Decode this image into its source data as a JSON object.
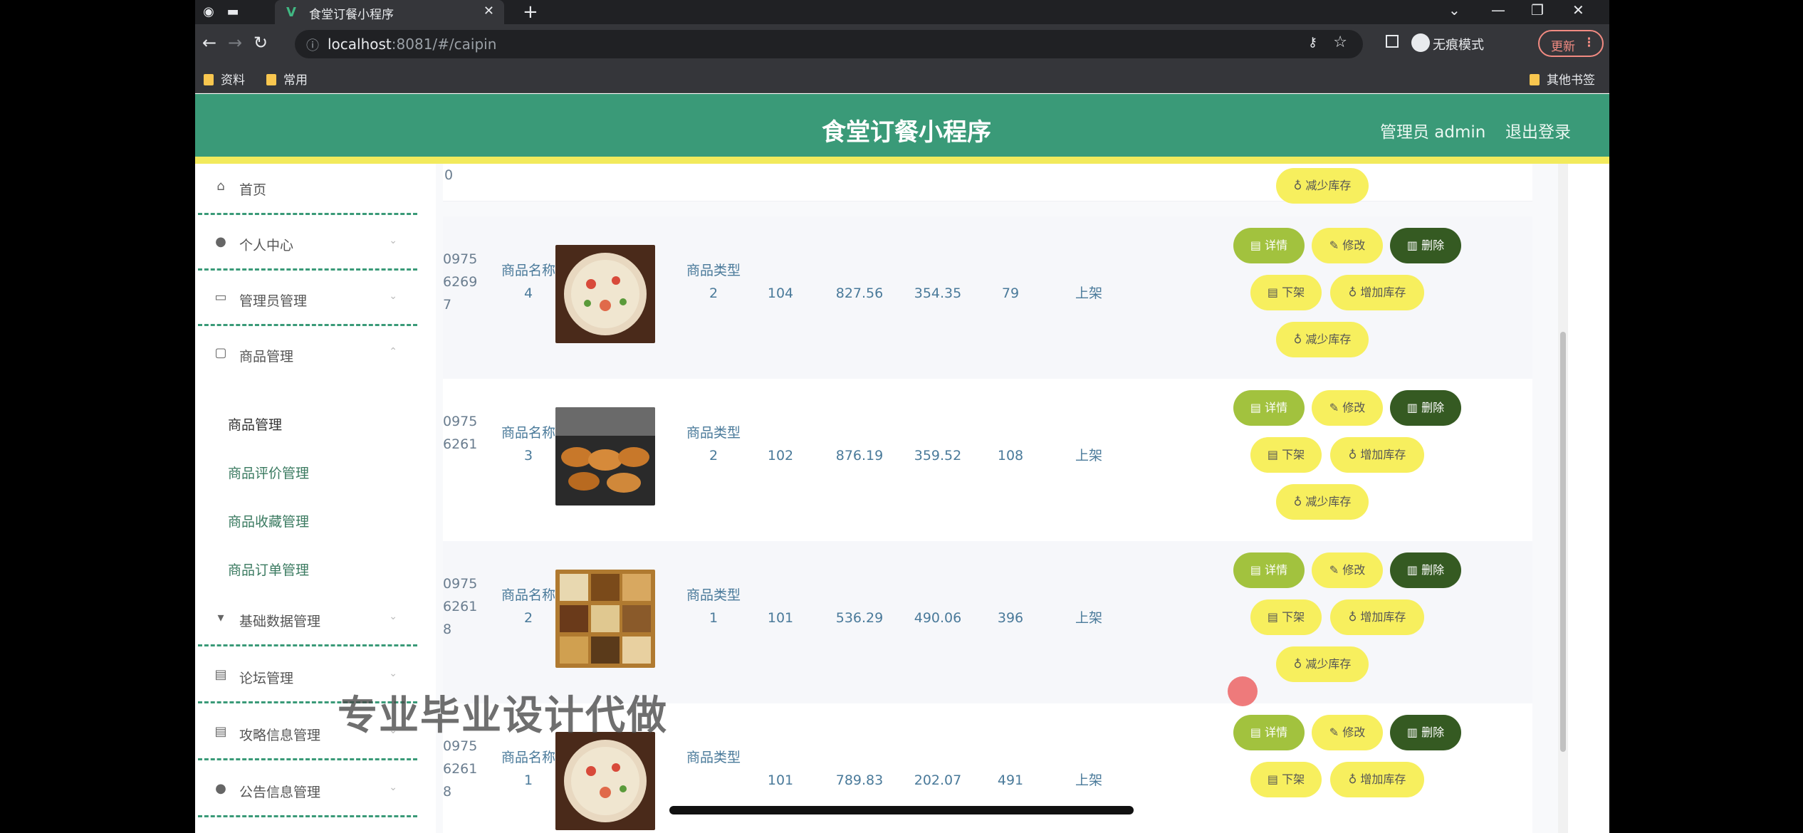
{
  "browser": {
    "tab_title": "食堂订餐小程序",
    "tab_favicon": "V",
    "url_host": "localhost",
    "url_rest": ":8081/#/caipin",
    "incognito_label": "无痕模式",
    "update_label": "更新",
    "bookmarks": [
      "资料",
      "常用"
    ],
    "other_bookmarks": "其他书签"
  },
  "header": {
    "title": "食堂订餐小程序",
    "admin": "管理员 admin",
    "logout": "退出登录"
  },
  "sidebar": {
    "items": [
      {
        "label": "首页",
        "icon": "home-icon"
      },
      {
        "label": "个人中心",
        "icon": "user-icon"
      },
      {
        "label": "管理员管理",
        "icon": "briefcase-icon"
      },
      {
        "label": "商品管理",
        "icon": "chat-icon"
      },
      {
        "label": "基础数据管理",
        "icon": "pin-icon"
      },
      {
        "label": "论坛管理",
        "icon": "clipboard-icon"
      },
      {
        "label": "攻略信息管理",
        "icon": "clipboard-icon"
      },
      {
        "label": "公告信息管理",
        "icon": "location-icon"
      }
    ],
    "subitems": [
      "商品管理",
      "商品评价管理",
      "商品收藏管理",
      "商品订单管理"
    ]
  },
  "table": {
    "top_partial": {
      "id_tail": "0",
      "button": "减少库存"
    },
    "rows": [
      {
        "id": [
          "0975",
          "6269",
          "7"
        ],
        "name": [
          "商品名称",
          "4"
        ],
        "type": [
          "商品类型",
          "2"
        ],
        "c1": "104",
        "price1": "827.56",
        "price2": "354.35",
        "stock": "79",
        "status": "上架"
      },
      {
        "id": [
          "0975",
          "6261",
          ""
        ],
        "name": [
          "商品名称",
          "3"
        ],
        "type": [
          "商品类型",
          "2"
        ],
        "c1": "102",
        "price1": "876.19",
        "price2": "359.52",
        "stock": "108",
        "status": "上架"
      },
      {
        "id": [
          "0975",
          "6261",
          "8"
        ],
        "name": [
          "商品名称",
          "2"
        ],
        "type": [
          "商品类型",
          "1"
        ],
        "c1": "101",
        "price1": "536.29",
        "price2": "490.06",
        "stock": "396",
        "status": "上架"
      },
      {
        "id": [
          "0975",
          "6261",
          "8"
        ],
        "name": [
          "商品名称",
          "1"
        ],
        "type": [
          "商品类型",
          ""
        ],
        "c1": "101",
        "price1": "789.83",
        "price2": "202.07",
        "stock": "491",
        "status": "上架"
      }
    ],
    "buttons": {
      "detail": "详情",
      "edit": "修改",
      "delete": "删除",
      "offshelf": "下架",
      "add_stock": "增加库存",
      "reduce_stock": "减少库存"
    }
  },
  "overlay": {
    "watermark": "专业毕业设计代做"
  },
  "colors": {
    "header_bg": "#3a9a78",
    "accent_yellow": "#f2ea5c",
    "detail_btn": "#a2c23e",
    "delete_btn": "#355a22"
  }
}
